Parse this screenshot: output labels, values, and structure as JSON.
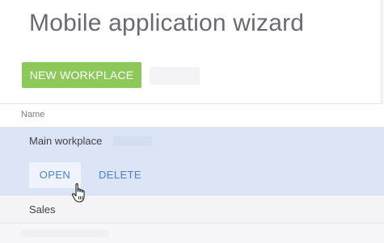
{
  "page": {
    "title": "Mobile application wizard"
  },
  "toolbar": {
    "new_workplace_label": "NEW WORKPLACE"
  },
  "grid": {
    "columns": [
      "Name"
    ],
    "rows": [
      {
        "name": "Main workplace",
        "selected": true,
        "actions": [
          "OPEN",
          "DELETE"
        ]
      },
      {
        "name": "Sales",
        "selected": false
      }
    ]
  },
  "colors": {
    "primary_button": "#8dc95a",
    "selected_row": "#dbe5f6",
    "link_action": "#4f7fc7",
    "title_text": "#6a6a74"
  },
  "icons": {
    "cursor": "hand-pointer-icon"
  }
}
